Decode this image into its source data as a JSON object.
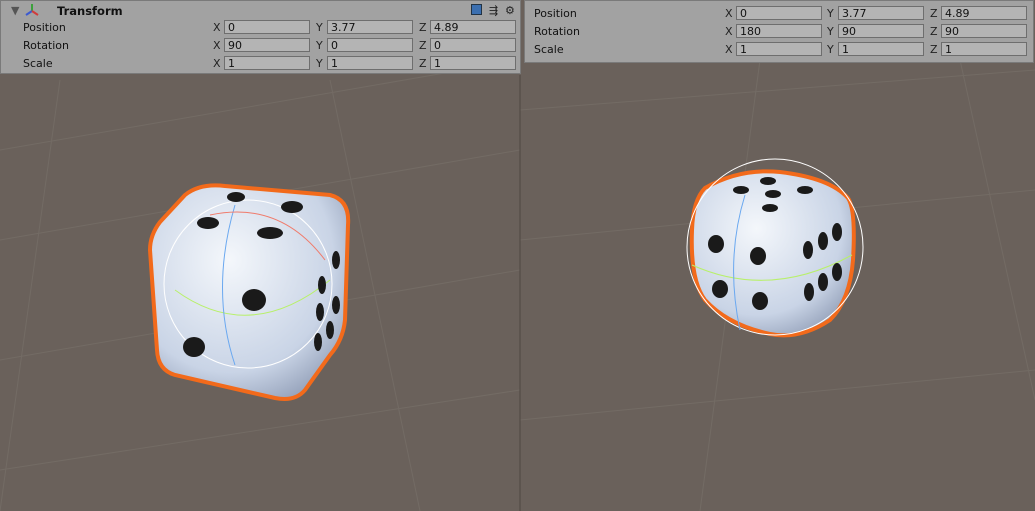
{
  "left_inspector": {
    "component_title": "Transform",
    "icons": [
      "foldout-arrow-icon",
      "transform-axes-icon",
      "help-book-icon",
      "preset-sliders-icon",
      "gear-icon"
    ],
    "rows": [
      {
        "label": "Position",
        "x": "0",
        "y": "3.77",
        "z": "4.89"
      },
      {
        "label": "Rotation",
        "x": "90",
        "y": "0",
        "z": "0"
      },
      {
        "label": "Scale",
        "x": "1",
        "y": "1",
        "z": "1"
      }
    ]
  },
  "right_inspector": {
    "rows": [
      {
        "label": "Position",
        "x": "0",
        "y": "3.77",
        "z": "4.89"
      },
      {
        "label": "Rotation",
        "x": "180",
        "y": "90",
        "z": "90"
      },
      {
        "label": "Scale",
        "x": "1",
        "y": "1",
        "z": "1"
      }
    ]
  },
  "axis_labels": {
    "x": "X",
    "y": "Y",
    "z": "Z"
  },
  "colors": {
    "scene_bg": "#6a615b",
    "selection_outline": "#f26a1b",
    "die_face": "#dfe7f2",
    "pip": "#1a1a1a"
  }
}
